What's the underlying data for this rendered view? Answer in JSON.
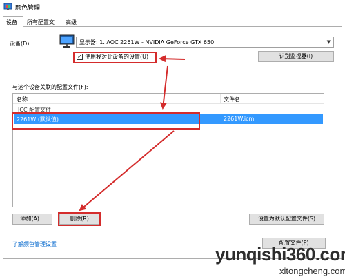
{
  "window": {
    "title": "颜色管理"
  },
  "tabs": [
    {
      "label": "设备"
    },
    {
      "label": "所有配置文件"
    },
    {
      "label": "高级"
    }
  ],
  "device": {
    "label": "设备(D):",
    "selected": "显示器: 1. AOC 2261W - NVIDIA GeForce GTX 650",
    "use_settings_label": "使用我对此设备的设置(U)",
    "use_settings_checked": true,
    "identify_button": "识别监视器(I)"
  },
  "profiles": {
    "label": "与这个设备关联的配置文件(F):",
    "columns": [
      "名称",
      "文件名"
    ],
    "group": "ICC 配置文件",
    "rows": [
      {
        "name": "2261W (默认值)",
        "file": "2261W.icm"
      }
    ]
  },
  "buttons": {
    "add": "添加(A)...",
    "remove": "删除(R)",
    "set_default": "设置为默认配置文件(S)",
    "profiles": "配置文件(P)"
  },
  "link": {
    "learn_more": "了解颜色管理设置"
  },
  "watermark": {
    "main": "yunqishi360.com",
    "sub": "xitongcheng.com"
  },
  "colors": {
    "selection": "#3399ff",
    "annotation": "#d42c2c",
    "link": "#0066cc"
  },
  "icons": [
    "color-management-icon",
    "monitor-icon",
    "chevron-down-icon",
    "checkmark-icon"
  ]
}
